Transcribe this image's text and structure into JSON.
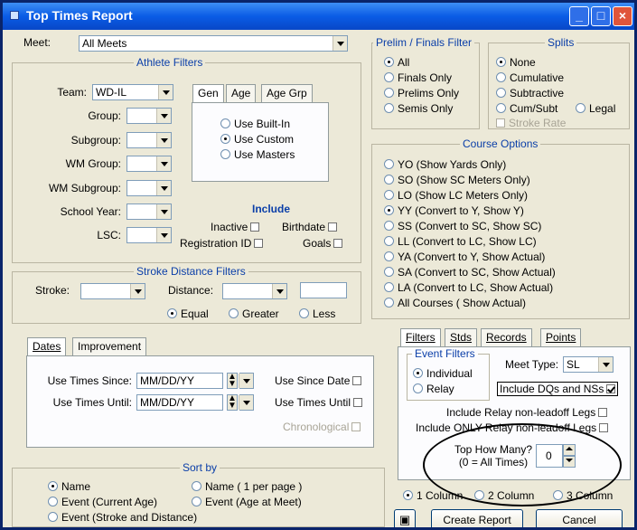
{
  "window": {
    "title": "Top Times Report"
  },
  "meet": {
    "label": "Meet:",
    "value": "All Meets"
  },
  "athlete_filters": {
    "title": "Athlete Filters",
    "team_label": "Team:",
    "team_value": "WD-IL",
    "group_label": "Group:",
    "subgroup_label": "Subgroup:",
    "wm_group_label": "WM Group:",
    "wm_subgroup_label": "WM Subgroup:",
    "school_year_label": "School Year:",
    "lsc_label": "LSC:",
    "tabs": [
      "Gen",
      "Age",
      "Age Grp"
    ],
    "age_options": [
      "Use Built-In",
      "Use Custom",
      "Use Masters"
    ],
    "include_title": "Include",
    "inactive": "Inactive",
    "birthdate": "Birthdate",
    "registration_id": "Registration ID",
    "goals": "Goals"
  },
  "prelim": {
    "title": "Prelim / Finals Filter",
    "options": [
      "All",
      "Finals Only",
      "Prelims Only",
      "Semis Only"
    ]
  },
  "splits": {
    "title": "Splits",
    "options": [
      "None",
      "Cumulative",
      "Subtractive",
      "Cum/Subt",
      "Legal"
    ],
    "stroke_rate": "Stroke Rate"
  },
  "course": {
    "title": "Course Options",
    "options": [
      "YO (Show Yards Only)",
      "SO (Show SC Meters Only)",
      "LO (Show LC Meters Only)",
      "YY (Convert to Y, Show Y)",
      "SS (Convert to SC, Show SC)",
      "LL (Convert to LC, Show LC)",
      "YA (Convert to Y, Show Actual)",
      "SA (Convert to SC, Show Actual)",
      "LA (Convert to LC, Show Actual)",
      "All Courses ( Show Actual)"
    ]
  },
  "stroke_distance": {
    "title": "Stroke Distance Filters",
    "stroke_label": "Stroke:",
    "distance_label": "Distance:",
    "options": [
      "Equal",
      "Greater",
      "Less"
    ]
  },
  "dates": {
    "tabs": [
      "Dates",
      "Improvement"
    ],
    "since_label": "Use Times Since:",
    "since_value": "MM/DD/YY",
    "until_label": "Use Times Until:",
    "until_value": "MM/DD/YY",
    "use_since_date": "Use Since Date",
    "use_times_until": "Use Times Until",
    "chronological": "Chronological"
  },
  "right_tabs": [
    "Filters",
    "Stds",
    "Records",
    "Points"
  ],
  "event_filters": {
    "title": "Event Filters",
    "options": [
      "Individual",
      "Relay"
    ],
    "meet_type_label": "Meet Type:",
    "meet_type_value": "SL",
    "include_dqs": "Include DQs and NSs",
    "relay_nonleadoff": "Include Relay non-leadoff  Legs",
    "only_relay": "Include ONLY Relay non-leadoff Legs",
    "top_how_many_line1": "Top How Many?",
    "top_how_many_line2": "(0 = All Times)",
    "top_how_many_value": "0"
  },
  "sort_by": {
    "title": "Sort by",
    "options": [
      "Name",
      "Name ( 1 per page )",
      "Event (Current Age)",
      "Event  (Age at Meet)",
      "Event (Stroke and Distance)"
    ]
  },
  "columns": {
    "options": [
      "1 Column",
      "2 Column",
      "3 Column"
    ]
  },
  "actions": {
    "create_report": "Create Report",
    "cancel": "Cancel"
  }
}
